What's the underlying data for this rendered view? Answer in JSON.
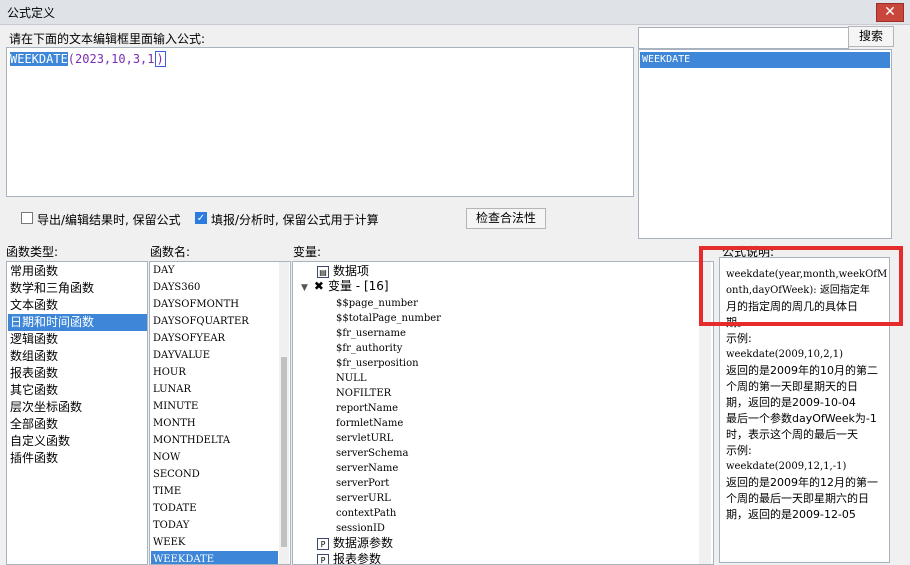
{
  "window": {
    "title": "公式定义",
    "close_label": "✕"
  },
  "editor": {
    "label": "请在下面的文本编辑框里面输入公式:",
    "selected_text": "WEEKDATE",
    "rest_text": "(2023,10,3,1",
    "caret_text": ")"
  },
  "search": {
    "input_value": "",
    "button_label": "搜索",
    "results": [
      "WEEKDATE"
    ]
  },
  "options": {
    "keep_formula_on_export": {
      "label": "导出/编辑结果时, 保留公式",
      "checked": false
    },
    "keep_formula_on_fill": {
      "label": "填报/分析时, 保留公式用于计算",
      "checked": true
    },
    "check_button_label": "检查合法性"
  },
  "function_types": {
    "header": "函数类型:",
    "items": [
      "常用函数",
      "数学和三角函数",
      "文本函数",
      "日期和时间函数",
      "逻辑函数",
      "数组函数",
      "报表函数",
      "其它函数",
      "层次坐标函数",
      "全部函数",
      "自定义函数",
      "插件函数"
    ],
    "selected": "日期和时间函数"
  },
  "function_names": {
    "header": "函数名:",
    "items": [
      "DAY",
      "DAYS360",
      "DAYSOFMONTH",
      "DAYSOFQUARTER",
      "DAYSOFYEAR",
      "DAYVALUE",
      "HOUR",
      "LUNAR",
      "MINUTE",
      "MONTH",
      "MONTHDELTA",
      "NOW",
      "SECOND",
      "TIME",
      "TODATE",
      "TODAY",
      "WEEK",
      "WEEKDATE"
    ],
    "selected": "WEEKDATE"
  },
  "variables": {
    "header": "变量:",
    "data_item_label": "数据项",
    "variable_group_label": "变量 - [16]",
    "items": [
      "$$page_number",
      "$$totalPage_number",
      "$fr_username",
      "$fr_authority",
      "$fr_userposition",
      "NULL",
      "NOFILTER",
      "reportName",
      "formletName",
      "servletURL",
      "serverSchema",
      "serverName",
      "serverPort",
      "serverURL",
      "contextPath",
      "sessionID"
    ],
    "datasource_params_label": "数据源参数",
    "report_params_label": "报表参数"
  },
  "description": {
    "header": "公式说明:",
    "lines": [
      {
        "text": "weekdate(year,month,weekOfM",
        "code": true
      },
      {
        "text": "onth,dayOfWeek): 返回指定年",
        "code": true
      },
      {
        "text": "月的指定周的周几的具体日",
        "code": false
      },
      {
        "text": "期。",
        "code": false
      },
      {
        "text": "示例:",
        "code": false
      },
      {
        "text": "weekdate(2009,10,2,1)",
        "code": true
      },
      {
        "text": "返回的是2009年的10月的第二",
        "code": false
      },
      {
        "text": "个周的第一天即星期天的日",
        "code": false
      },
      {
        "text": "期，返回的是2009-10-04",
        "code": false
      },
      {
        "text": "最后一个参数dayOfWeek为-1",
        "code": false
      },
      {
        "text": "时，表示这个周的最后一天",
        "code": false
      },
      {
        "text": "示例:",
        "code": false
      },
      {
        "text": "weekdate(2009,12,1,-1)",
        "code": true
      },
      {
        "text": "返回的是2009年的12月的第一",
        "code": false
      },
      {
        "text": "个周的最后一天即星期六的日",
        "code": false
      },
      {
        "text": "期，返回的是2009-12-05",
        "code": false
      }
    ]
  },
  "colors": {
    "selection": "#3d86d8",
    "highlight_border": "#e52b2b",
    "formula_text": "#7a2fb0"
  }
}
